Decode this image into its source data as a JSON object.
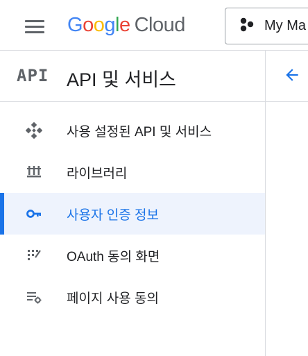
{
  "header": {
    "logo_parts": [
      "G",
      "o",
      "o",
      "g",
      "l",
      "e"
    ],
    "logo_product": "Cloud",
    "project_label": "My Ma"
  },
  "sidebar": {
    "badge": "API",
    "title": "API 및 서비스",
    "items": [
      {
        "label": "사용 설정된 API 및 서비스",
        "icon": "api-diamond-icon",
        "active": false
      },
      {
        "label": "라이브러리",
        "icon": "library-icon",
        "active": false
      },
      {
        "label": "사용자 인증 정보",
        "icon": "key-icon",
        "active": true
      },
      {
        "label": "OAuth 동의 화면",
        "icon": "consent-screen-icon",
        "active": false
      },
      {
        "label": "페이지 사용 동의",
        "icon": "page-settings-icon",
        "active": false
      }
    ]
  },
  "colors": {
    "accent": "#1a73e8",
    "active_bg": "#eef3fd",
    "icon_gray": "#5f6368",
    "divider": "#dadce0"
  }
}
